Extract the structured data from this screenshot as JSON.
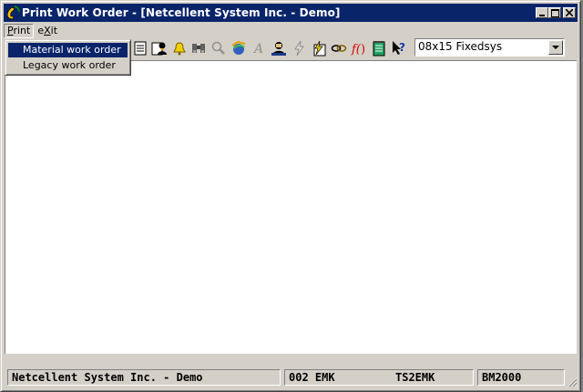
{
  "window": {
    "title": "Print Work Order - [Netcellent System Inc. - Demo]",
    "icon": "phone-handset-icon",
    "controls": [
      "minimize",
      "maximize",
      "close"
    ]
  },
  "menubar": {
    "print": "Print",
    "print_mnemonic": "P",
    "exit": "eXit",
    "exit_mnemonic": "X"
  },
  "print_menu": {
    "items": [
      {
        "label": "Material work order",
        "selected": true
      },
      {
        "label": "Legacy work order",
        "selected": false
      }
    ]
  },
  "toolbar": {
    "icons": [
      "document-icon",
      "user-list-icon",
      "bell-icon",
      "binoculars-icon",
      "magnifier-icon",
      "browser-icon",
      "font-icon",
      "person-icon",
      "lightning-icon",
      "lightning-calc-icon",
      "link-icon",
      "function-icon",
      "notepad-icon",
      "context-help-icon"
    ],
    "font_select": {
      "value": "08x15 Fixedsys"
    }
  },
  "statusbar": {
    "company": "Netcellent System Inc. - Demo",
    "code1": "002 EMK",
    "code2": "TS2EMK",
    "code3": "BM2000"
  },
  "colors": {
    "titlebar": "#0a246a",
    "face": "#d4d0c8",
    "selection": "#0a246a"
  }
}
